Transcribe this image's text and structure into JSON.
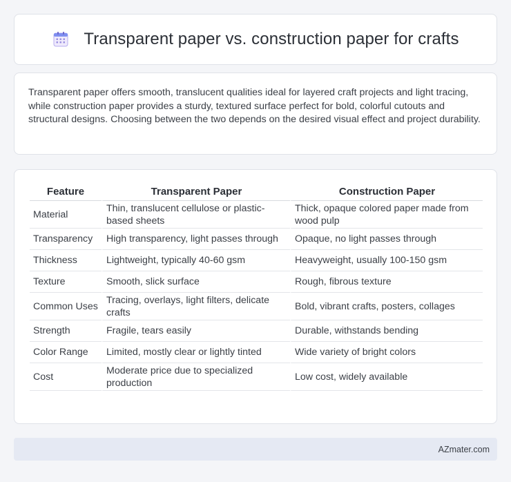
{
  "header": {
    "title": "Transparent paper vs. construction paper for crafts",
    "icon": "calendar-icon"
  },
  "intro": {
    "text": "Transparent paper offers smooth, translucent qualities ideal for layered craft projects and light tracing, while construction paper provides a sturdy, textured surface perfect for bold, colorful cutouts and structural designs. Choosing between the two depends on the desired visual effect and project durability."
  },
  "table": {
    "headers": [
      "Feature",
      "Transparent Paper",
      "Construction Paper"
    ],
    "rows": [
      [
        "Material",
        "Thin, translucent cellulose or plastic-based sheets",
        "Thick, opaque colored paper made from wood pulp"
      ],
      [
        "Transparency",
        "High transparency, light passes through",
        "Opaque, no light passes through"
      ],
      [
        "Thickness",
        "Lightweight, typically 40-60 gsm",
        "Heavyweight, usually 100-150 gsm"
      ],
      [
        "Texture",
        "Smooth, slick surface",
        "Rough, fibrous texture"
      ],
      [
        "Common Uses",
        "Tracing, overlays, light filters, delicate crafts",
        "Bold, vibrant crafts, posters, collages"
      ],
      [
        "Strength",
        "Fragile, tears easily",
        "Durable, withstands bending"
      ],
      [
        "Color Range",
        "Limited, mostly clear or lightly tinted",
        "Wide variety of bright colors"
      ],
      [
        "Cost",
        "Moderate price due to specialized production",
        "Low cost, widely available"
      ]
    ]
  },
  "footer": {
    "brand": "AZmater.com"
  },
  "colors": {
    "page_background": "#f4f5f8",
    "card_background": "#ffffff",
    "footer_background": "#e5e9f3",
    "icon_accent": "#8a7fd8"
  }
}
